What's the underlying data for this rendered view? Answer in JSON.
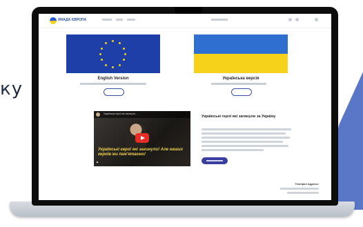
{
  "side_text": "ку",
  "site": {
    "logo_text": "ЯНАДА ЄВРОПА",
    "english": {
      "title": "English Version"
    },
    "ukrainian": {
      "title": "Українська версія"
    },
    "video": {
      "title": "Українські герої які загинули...",
      "caption": "Українські герої які загинули! Але наших героїв ми пам'ятаємо!"
    },
    "promo": {
      "heading": "Українські герої які загинули за Україну"
    },
    "footer": {
      "title": "Телефон Адреси:"
    }
  },
  "colors": {
    "accent": "#5a77c7",
    "eu_blue": "#1f3fa8",
    "ua_blue": "#2f6fd0",
    "ua_yellow": "#f6d21a",
    "button": "#3a3f9e",
    "play_red": "#e52d27"
  }
}
